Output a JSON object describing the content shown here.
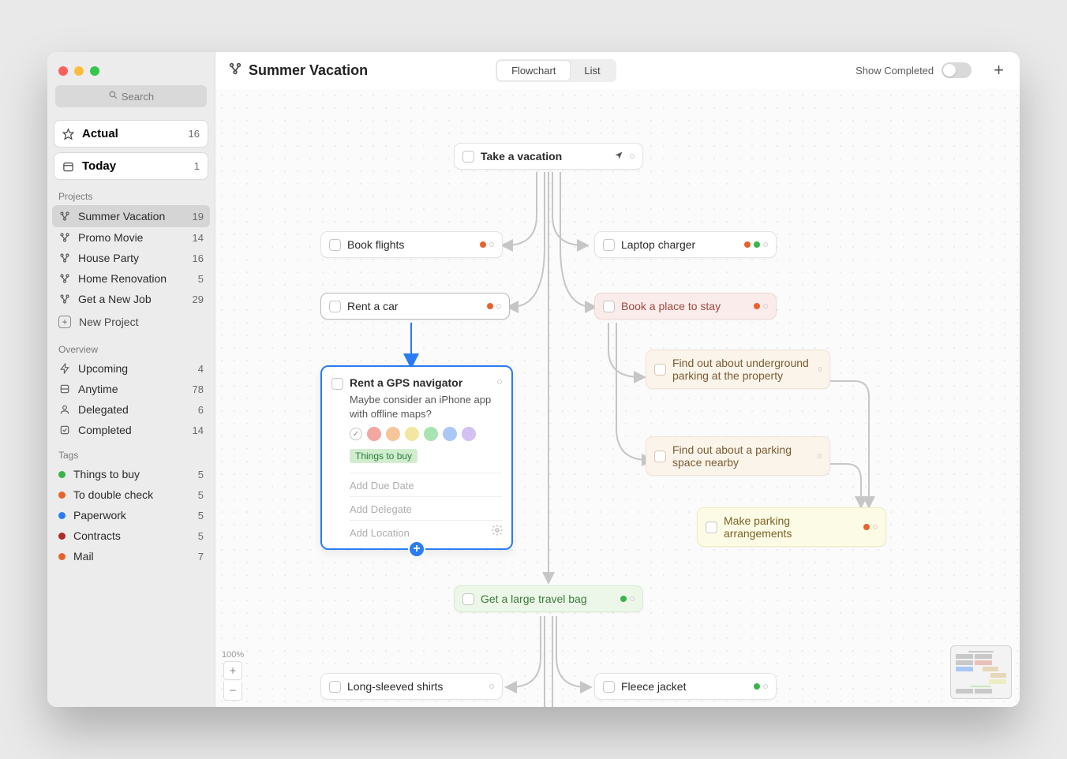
{
  "search_placeholder": "Search",
  "header": {
    "title": "Summer Vacation",
    "view_flowchart": "Flowchart",
    "view_list": "List",
    "show_completed": "Show Completed"
  },
  "nav": {
    "actual": {
      "label": "Actual",
      "count": "16"
    },
    "today": {
      "label": "Today",
      "count": "1"
    }
  },
  "section_labels": {
    "projects": "Projects",
    "overview": "Overview",
    "tags": "Tags"
  },
  "projects": [
    {
      "label": "Summer Vacation",
      "count": "19"
    },
    {
      "label": "Promo Movie",
      "count": "14"
    },
    {
      "label": "House Party",
      "count": "16"
    },
    {
      "label": "Home Renovation",
      "count": "5"
    },
    {
      "label": "Get a New Job",
      "count": "29"
    }
  ],
  "new_project_label": "New Project",
  "overview": [
    {
      "label": "Upcoming",
      "count": "4"
    },
    {
      "label": "Anytime",
      "count": "78"
    },
    {
      "label": "Delegated",
      "count": "6"
    },
    {
      "label": "Completed",
      "count": "14"
    }
  ],
  "tags": [
    {
      "label": "Things to buy",
      "count": "5",
      "color": "#39b44a"
    },
    {
      "label": "To double check",
      "count": "5",
      "color": "#e9622c"
    },
    {
      "label": "Paperwork",
      "count": "5",
      "color": "#2a7bf4"
    },
    {
      "label": "Contracts",
      "count": "5",
      "color": "#b02a2a"
    },
    {
      "label": "Mail",
      "count": "7",
      "color": "#e9622c"
    }
  ],
  "zoom_label": "100%",
  "cards": {
    "root": "Take a vacation",
    "book_flights": "Book flights",
    "laptop_charger": "Laptop charger",
    "rent_car": "Rent a car",
    "book_place": "Book a place to stay",
    "underground_parking": "Find out about underground parking at the property",
    "parking_nearby": "Find out about a parking space nearby",
    "make_parking": "Make parking arrangements",
    "travel_bag": "Get a large travel bag",
    "shirts": "Long-sleeved shirts",
    "fleece": "Fleece jacket"
  },
  "detail": {
    "title": "Rent a GPS navigator",
    "note": "Maybe consider an iPhone app with offline maps?",
    "tag": "Things to buy",
    "fields": {
      "due": "Add Due Date",
      "delegate": "Add Delegate",
      "location": "Add Location"
    },
    "palette": {
      "red": "#f2a7a1",
      "orange": "#f6c69a",
      "yellow": "#f3e6a0",
      "green": "#a9e3b1",
      "blue": "#aac8f4",
      "purple": "#d2c1f1"
    }
  },
  "dot_colors": {
    "orange": "#e9622c",
    "green": "#39b44a"
  }
}
